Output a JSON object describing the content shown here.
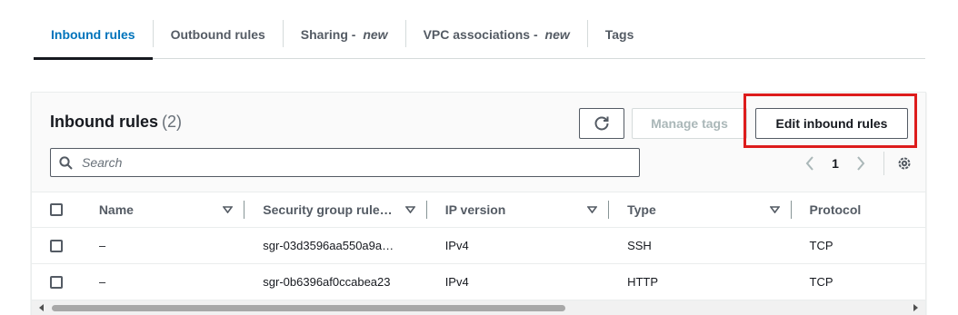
{
  "tabs": [
    {
      "label": "Inbound rules",
      "suffix": ""
    },
    {
      "label": "Outbound rules",
      "suffix": ""
    },
    {
      "label": "Sharing - ",
      "suffix": "new"
    },
    {
      "label": "VPC associations - ",
      "suffix": "new"
    },
    {
      "label": "Tags",
      "suffix": ""
    }
  ],
  "active_tab": "Inbound rules",
  "panel": {
    "title": "Inbound rules",
    "count": "(2)",
    "manage_tags_label": "Manage tags",
    "edit_label": "Edit inbound rules"
  },
  "search": {
    "placeholder": "Search",
    "value": ""
  },
  "pagination": {
    "current_page": "1"
  },
  "table": {
    "columns": [
      "Name",
      "Security group rule…",
      "IP version",
      "Type",
      "Protocol"
    ],
    "rows": [
      {
        "name": "–",
        "sgr_id": "sgr-03d3596aa550a9a…",
        "ip_version": "IPv4",
        "type": "SSH",
        "protocol": "TCP"
      },
      {
        "name": "–",
        "sgr_id": "sgr-0b6396af0ccabea23",
        "ip_version": "IPv4",
        "type": "HTTP",
        "protocol": "TCP"
      }
    ]
  },
  "colors": {
    "accent": "#0073bb",
    "highlight": "#dd1c1c",
    "text": "#16191f",
    "muted": "#545b64"
  },
  "icons": [
    "refresh-icon",
    "search-icon",
    "chevron-left-icon",
    "chevron-right-icon",
    "gear-icon",
    "sort-caret-icon"
  ]
}
